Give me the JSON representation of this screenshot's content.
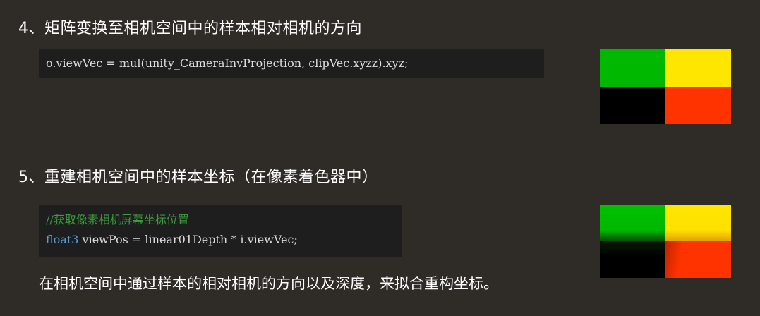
{
  "section1": {
    "heading": "4、矩阵变换至相机空间中的样本相对相机的方向",
    "code": "o.viewVec = mul(unity_CameraInvProjection, clipVec.xyzz).xyz;"
  },
  "section2": {
    "heading": "5、重建相机空间中的样本坐标（在像素着色器中）",
    "code_comment": "//获取像素相机屏幕坐标位置",
    "code_keyword": "float3",
    "code_rest": " viewPos = linear01Depth * i.viewVec;",
    "footer": "在相机空间中通过样本的相对相机的方向以及深度，来拟合重构坐标。"
  },
  "colors": {
    "background": "#2f2b27",
    "quad_top_left": "#00b800",
    "quad_top_right": "#ffe600",
    "quad_bottom_left": "#000000",
    "quad_bottom_right": "#ff3300"
  }
}
